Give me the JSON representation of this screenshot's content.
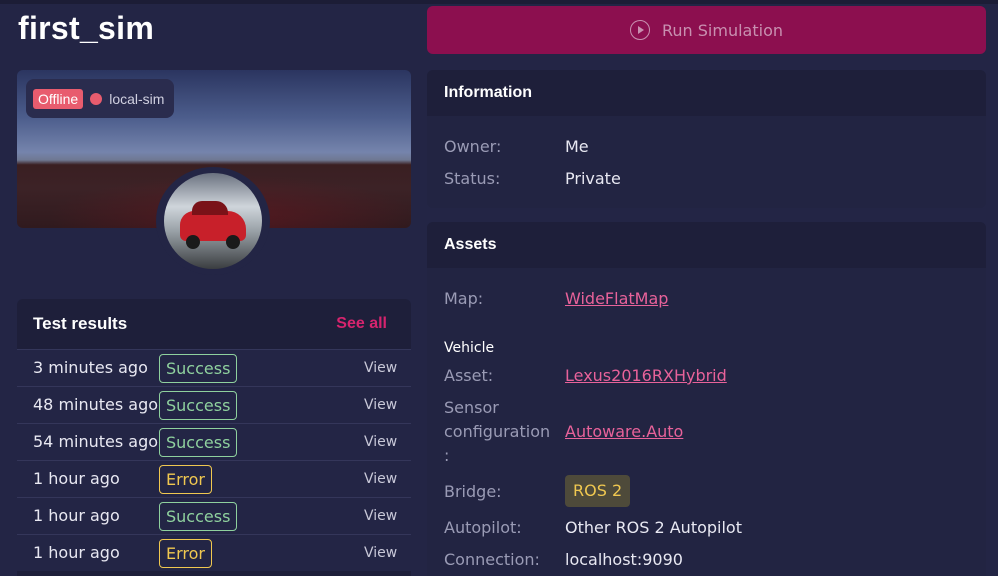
{
  "title": "first_sim",
  "run_button": {
    "label": "Run Simulation"
  },
  "preview": {
    "status": "Offline",
    "cluster": "local-sim",
    "status_color": "#e85c6e"
  },
  "test_results": {
    "heading": "Test results",
    "see_all": "See all",
    "rows": [
      {
        "time": "3 minutes ago",
        "result": "Success",
        "view": "View"
      },
      {
        "time": "48 minutes ago",
        "result": "Success",
        "view": "View"
      },
      {
        "time": "54 minutes ago",
        "result": "Success",
        "view": "View"
      },
      {
        "time": "1 hour ago",
        "result": "Error",
        "view": "View"
      },
      {
        "time": "1 hour ago",
        "result": "Success",
        "view": "View"
      },
      {
        "time": "1 hour ago",
        "result": "Error",
        "view": "View"
      }
    ]
  },
  "information": {
    "heading": "Information",
    "owner_label": "Owner:",
    "owner_value": "Me",
    "status_label": "Status:",
    "status_value": "Private"
  },
  "assets": {
    "heading": "Assets",
    "map_label": "Map:",
    "map_value": "WideFlatMap",
    "vehicle_heading": "Vehicle",
    "asset_label": "Asset:",
    "asset_value": "Lexus2016RXHybrid",
    "sensor_label_1": "Sensor",
    "sensor_label_2": "configuration",
    "sensor_label_3": ":",
    "sensor_value": "Autoware.Auto",
    "bridge_label": "Bridge:",
    "bridge_value": "ROS 2",
    "autopilot_label": "Autopilot:",
    "autopilot_value": "Other ROS 2 Autopilot",
    "connection_label": "Connection:",
    "connection_value": "localhost:9090"
  },
  "colors": {
    "accent": "#d6246e",
    "run_button": "#8c0f4f",
    "success": "#8fd19e",
    "error": "#f0c850"
  }
}
